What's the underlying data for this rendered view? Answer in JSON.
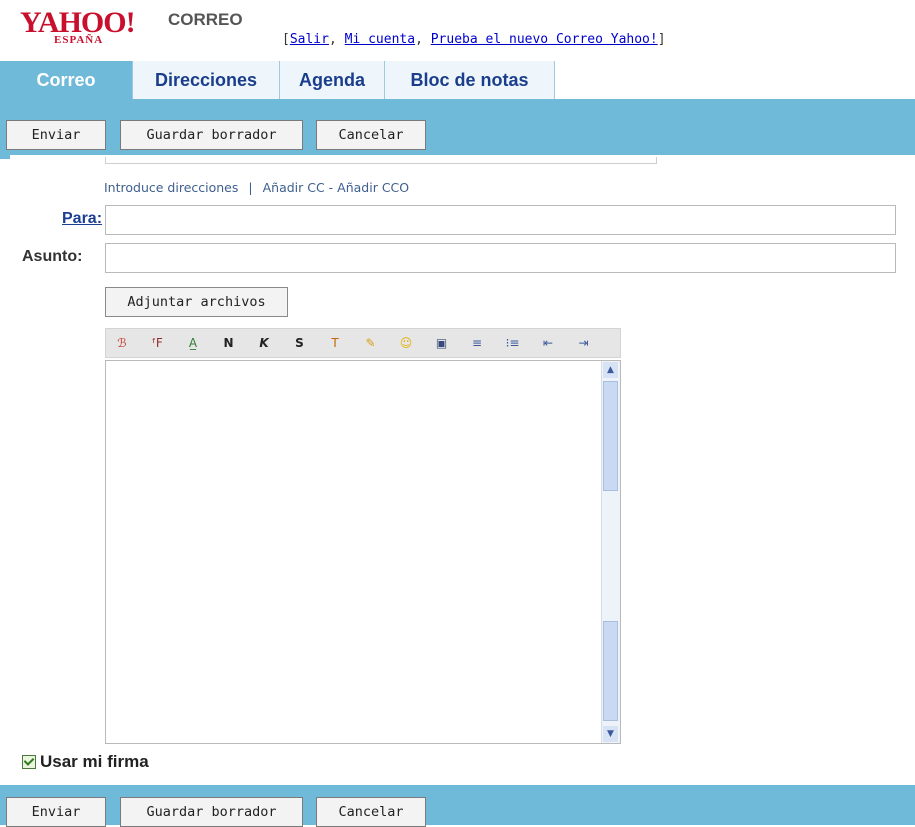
{
  "brand": {
    "logo_word": "YAHOO!",
    "logo_region": "ESPAÑA",
    "product": "CORREO"
  },
  "toplinks": {
    "open_bracket": "[",
    "salir": "Salir",
    "sep1": ", ",
    "mi_cuenta": "Mi cuenta",
    "sep2": ", ",
    "prueba": "Prueba el nuevo Correo Yahoo!",
    "close_bracket": "]"
  },
  "tabs": [
    {
      "label": "Correo",
      "active": true
    },
    {
      "label": "Direcciones",
      "active": false
    },
    {
      "label": "Agenda",
      "active": false
    },
    {
      "label": "Bloc de notas",
      "active": false
    }
  ],
  "actions": {
    "send": "Enviar",
    "save_draft": "Guardar borrador",
    "cancel": "Cancelar"
  },
  "compose": {
    "enter_addresses": "Introduce direcciones",
    "separator": "|",
    "add_cc": "Añadir CC - Añadir CCO",
    "to_label": "Para:",
    "subject_label": "Asunto:",
    "to_value": "",
    "subject_value": "",
    "attach_label": "Adjuntar archivos",
    "signature_label": "Usar mi firma",
    "signature_checked": true
  },
  "format_toolbar": [
    "spellcheck-icon",
    "font-icon",
    "font-size-icon",
    "bold-icon",
    "italic-icon",
    "underline-icon",
    "text-color-icon",
    "highlight-icon",
    "emoticon-icon",
    "insert-image-icon",
    "align-icon",
    "bulleted-list-icon",
    "outdent-icon",
    "indent-icon"
  ],
  "format_glyphs": [
    "ℬ",
    "ᶠF",
    "A̲",
    "N",
    "K",
    "S",
    "T",
    "✎",
    "☺",
    "▣",
    "≡",
    "⁝≡",
    "⇤",
    "⇥"
  ],
  "colors": {
    "accent": "#6fbad9",
    "tab_text": "#1a3e8c",
    "brand_red": "#c8102e"
  }
}
